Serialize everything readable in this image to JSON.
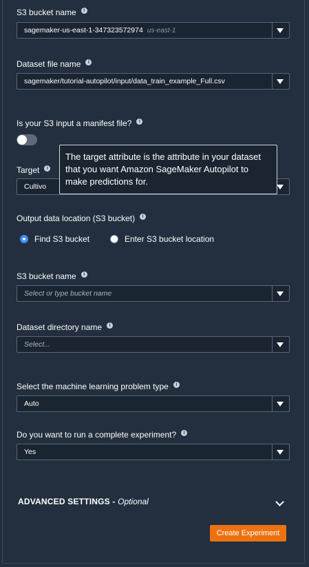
{
  "fields": {
    "s3_bucket_name_label": "S3 bucket name",
    "s3_bucket_value": "sagemaker-us-east-1-347323572974",
    "s3_bucket_region": "us-east-1",
    "dataset_file_label": "Dataset file name",
    "dataset_file_value": "sagemaker/tutorial-autopilot/input/data_train_example_Full.csv",
    "manifest_label": "Is your S3 input a manifest file?",
    "manifest_toggle_on": false,
    "target_label": "Target",
    "target_value": "Cultivo",
    "output_label": "Output data location (S3 bucket)",
    "radio_find": "Find S3 bucket",
    "radio_enter": "Enter S3 bucket location",
    "output_bucket_label": "S3 bucket name",
    "output_bucket_placeholder": "Select or type bucket name",
    "dataset_dir_label": "Dataset directory name",
    "dataset_dir_placeholder": "Select...",
    "problem_type_label": "Select the machine learning problem type",
    "problem_type_value": "Auto",
    "complete_exp_label": "Do you want to run a complete experiment?",
    "complete_exp_value": "Yes"
  },
  "tooltip": {
    "text": "The target attribute is the attribute in your dataset that you want Amazon SageMaker Autopilot to make predictions for."
  },
  "advanced": {
    "title": "ADVANCED SETTINGS -",
    "optional": "Optional"
  },
  "actions": {
    "create_label": "Create Experiment"
  },
  "colors": {
    "background": "#232f3e",
    "primary_button": "#ec7211",
    "radio_selected": "#3f8bfd"
  }
}
